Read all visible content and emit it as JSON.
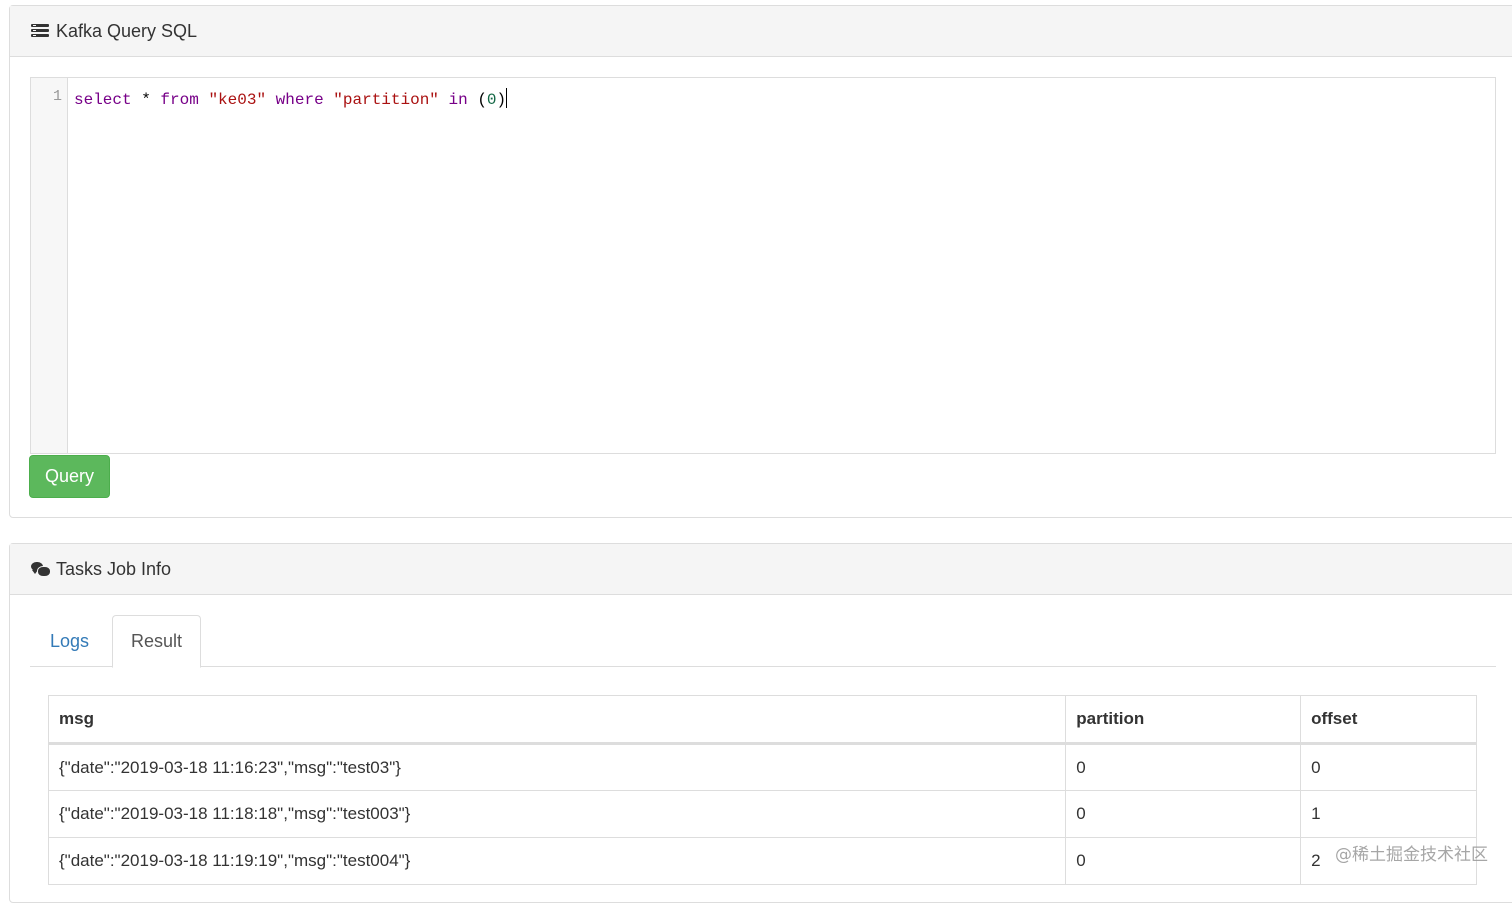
{
  "query_panel": {
    "title": "Kafka Query SQL",
    "icon": "tasks-icon",
    "editor": {
      "line_number": "1",
      "tokens": {
        "t1": "select",
        "t2": " * ",
        "t3": "from",
        "t4": " ",
        "t5": "\"ke03\"",
        "t6": " ",
        "t7": "where",
        "t8": " ",
        "t9": "\"partition\"",
        "t10": " ",
        "t11": "in",
        "t12": " (",
        "t13": "0",
        "t14": ")"
      }
    },
    "query_button_label": "Query",
    "button_color": "#5cb85c"
  },
  "tasks_panel": {
    "title": "Tasks Job Info",
    "icon": "comments-icon",
    "tabs": [
      {
        "label": "Logs",
        "active": false
      },
      {
        "label": "Result",
        "active": true
      }
    ],
    "table": {
      "headers": [
        "msg",
        "partition",
        "offset"
      ],
      "rows": [
        [
          "{\"date\":\"2019-03-18 11:16:23\",\"msg\":\"test03\"}",
          "0",
          "0"
        ],
        [
          "{\"date\":\"2019-03-18 11:18:18\",\"msg\":\"test003\"}",
          "0",
          "1"
        ],
        [
          "{\"date\":\"2019-03-18 11:19:19\",\"msg\":\"test004\"}",
          "0",
          "2"
        ]
      ]
    }
  },
  "watermark": "@稀土掘金技术社区"
}
